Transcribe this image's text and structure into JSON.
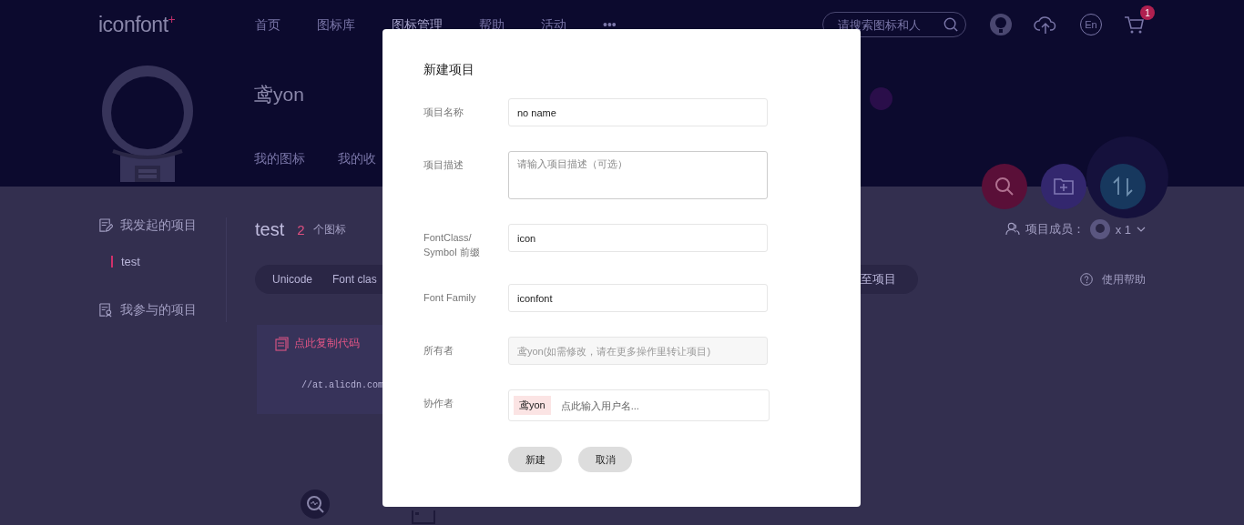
{
  "header": {
    "logo": "iconfont",
    "logo_mark": "+",
    "nav": [
      {
        "label": "首页",
        "selected": false
      },
      {
        "label": "图标库",
        "selected": false
      },
      {
        "label": "图标管理",
        "selected": true
      },
      {
        "label": "帮助",
        "selected": false
      },
      {
        "label": "活动",
        "selected": false
      },
      {
        "label": "•••",
        "selected": false
      }
    ],
    "search": {
      "placeholder": "请搜索图标和人"
    },
    "language": "En",
    "cart_badge": "1"
  },
  "profile": {
    "name": "鸢yon",
    "tabs": [
      "我的图标",
      "我的收"
    ]
  },
  "sidebar": {
    "sections": [
      {
        "label": "我发起的项目",
        "children": [
          {
            "label": "test",
            "selected": true
          }
        ]
      },
      {
        "label": "我参与的项目"
      }
    ]
  },
  "project": {
    "title": "test",
    "icon_count": "2",
    "icon_count_label": "个图标",
    "members_label": "项目成员：",
    "members_count": "x 1",
    "code_tabs": [
      "Unicode",
      "Font clas"
    ],
    "action": "至项目",
    "help": "使用帮助",
    "copy_code": "点此复制代码",
    "code": "//at.alicdn.com"
  },
  "dialog": {
    "title": "新建项目",
    "fields": [
      {
        "label": "项目名称",
        "kind": "text",
        "value": "no name"
      },
      {
        "label": "项目描述",
        "kind": "textarea",
        "placeholder": "请输入项目描述（可选）"
      },
      {
        "label": "FontClass/ Symbol 前缀",
        "kind": "text",
        "value": "icon"
      },
      {
        "label": "Font Family",
        "kind": "text",
        "value": "iconfont"
      },
      {
        "label": "所有者",
        "kind": "text",
        "placeholder": "鸢yon(如需修改，请在更多操作里转让项目)",
        "disabled": true
      },
      {
        "label": "协作者",
        "kind": "tags",
        "tags": [
          "鸢yon"
        ],
        "placeholder": "点此输入用户名..."
      }
    ],
    "buttons": [
      "新建",
      "取消"
    ]
  }
}
